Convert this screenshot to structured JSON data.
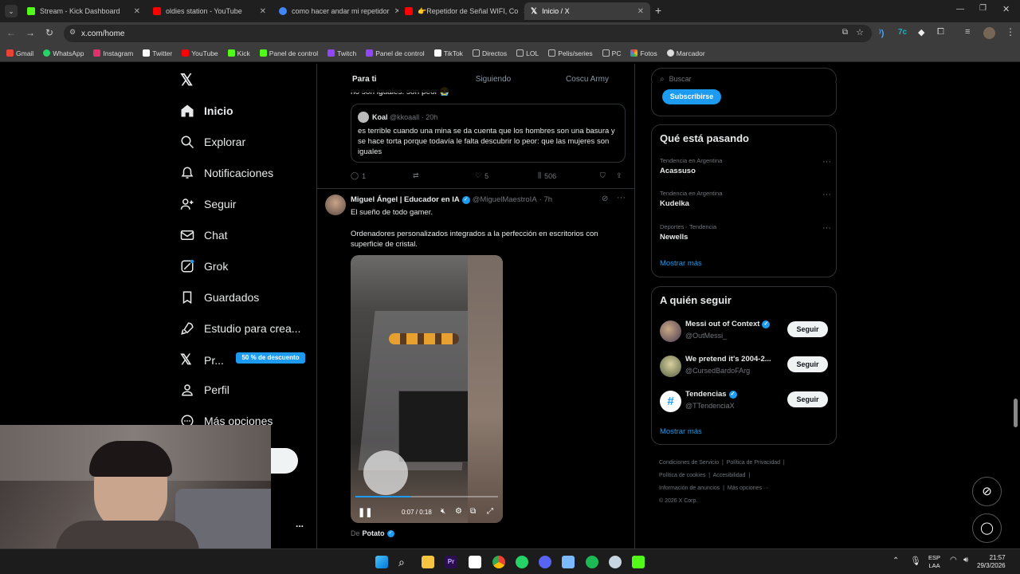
{
  "browser": {
    "tabs": [
      {
        "title": "Stream - Kick Dashboard",
        "color": "#53fc18"
      },
      {
        "title": "oldies station - YouTube",
        "color": "#ff0000"
      },
      {
        "title": "como hacer andar mi repetidor",
        "color": "#4285f4"
      },
      {
        "title": "👉Repetidor de Señal WIFI, Co",
        "color": "#ff0000"
      },
      {
        "title": "Inicio / X",
        "color": "#ffffff"
      }
    ],
    "url": "x.com/home",
    "bookmarks": [
      {
        "label": "Gmail",
        "color": "#ea4335"
      },
      {
        "label": "WhatsApp",
        "color": "#25d366"
      },
      {
        "label": "Instagram",
        "color": "#e1306c"
      },
      {
        "label": "Twitter",
        "color": "#ffffff"
      },
      {
        "label": "YouTube",
        "color": "#ff0000"
      },
      {
        "label": "Kick",
        "color": "#53fc18"
      },
      {
        "label": "Panel de control",
        "color": "#53fc18"
      },
      {
        "label": "Twitch",
        "color": "#9146ff"
      },
      {
        "label": "Panel de control",
        "color": "#9146ff"
      },
      {
        "label": "TikTok",
        "color": "#ffffff"
      },
      {
        "label": "Directos",
        "color": "#bbbbbb"
      },
      {
        "label": "LOL",
        "color": "#bbbbbb"
      },
      {
        "label": "Pelis/series",
        "color": "#bbbbbb"
      },
      {
        "label": "PC",
        "color": "#bbbbbb"
      },
      {
        "label": "Fotos",
        "color": "#fbbc05"
      },
      {
        "label": "Marcador",
        "color": "#dddddd"
      }
    ]
  },
  "nav": {
    "items": [
      "Inicio",
      "Explorar",
      "Notificaciones",
      "Seguir",
      "Chat",
      "Grok",
      "Guardados",
      "Estudio para crea..."
    ],
    "premium": "Pr...",
    "premium_badge": "50 % de descuento",
    "profile": "Perfil",
    "more": "Más opciones",
    "dots": "..."
  },
  "timeline": {
    "tabs": [
      "Para ti",
      "Siguiendo",
      "Coscu Army"
    ],
    "post1": {
      "cut_text": "no son iguales. son peor 😭",
      "quote_name": "Koal",
      "quote_handle": "@kkoaall",
      "quote_time": "· 20h",
      "quote_text": "es terrible cuando una mina se da cuenta que los hombres son una basura y se hace torta porque todavía le falta descubrir lo peor: que las mujeres son iguales",
      "replies": "1",
      "likes": "5",
      "views": "506"
    },
    "post2": {
      "name": "Miguel Ángel | Educador en IA",
      "handle": "@MiguelMaestroIA",
      "time": "· 7h",
      "line1": "El sueño de todo gamer.",
      "line2": "Ordenadores personalizados integrados a la perfección en escritorios con superficie de cristal.",
      "video_time": "0:07 / 0:18",
      "video_progress": 0.39,
      "source_prefix": "De",
      "source_name": "Potato"
    }
  },
  "sidebar": {
    "search_placeholder": "Buscar",
    "subscribe": "Subscribirse",
    "trends_title": "Qué está pasando",
    "trends": [
      {
        "context": "Tendencia en Argentina",
        "name": "Acassuso"
      },
      {
        "context": "Tendencia en Argentina",
        "name": "Kudelka"
      },
      {
        "context": "Deportes · Tendencia",
        "name": "Newells"
      }
    ],
    "show_more": "Mostrar más",
    "follow_title": "A quién seguir",
    "follow": [
      {
        "name": "Messi out of Context",
        "handle": "@OutMessi_",
        "verified": true
      },
      {
        "name": "We pretend it's 2004-2...",
        "handle": "@CursedBardoFArg",
        "verified": false
      },
      {
        "name": "Tendencias",
        "handle": "@TTendenciaX",
        "verified": true
      }
    ],
    "follow_button": "Seguir",
    "footer": [
      "Condiciones de Servicio",
      "Política de Privacidad",
      "Política de cookies",
      "Accesibilidad",
      "Información de anuncios",
      "Más opciones ···",
      "© 2026 X Corp."
    ]
  },
  "taskbar": {
    "lang1": "ESP",
    "lang2": "LAA",
    "time": "21:57",
    "date": "29/3/2026"
  }
}
